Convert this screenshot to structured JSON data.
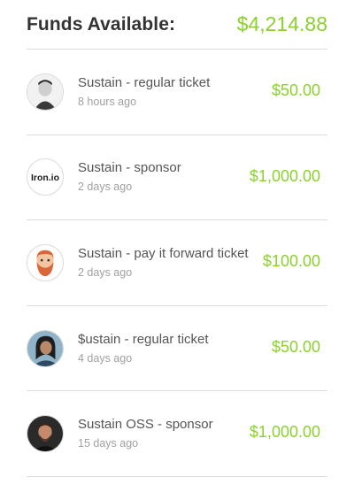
{
  "header": {
    "title": "Funds Available:",
    "amount": "$4,214.88"
  },
  "colors": {
    "accent": "#8bd12b",
    "divider": "#dcdcdc",
    "text": "#555555",
    "muted": "#a0a0a0"
  },
  "transactions": [
    {
      "title": "Sustain - regular ticket",
      "time": "8 hours ago",
      "amount": "$50.00",
      "avatar": "man-portrait-avatar"
    },
    {
      "title": "Sustain - sponsor",
      "time": "2 days ago",
      "amount": "$1,000.00",
      "avatar": "iron-io-logo"
    },
    {
      "title": "Sustain - pay it forward ticket",
      "time": "2 days ago",
      "amount": "$100.00",
      "avatar": "bearded-cartoon-avatar"
    },
    {
      "title": "$ustain - regular ticket",
      "time": "4 days ago",
      "amount": "$50.00",
      "avatar": "woman-portrait-avatar"
    },
    {
      "title": "Sustain OSS - sponsor",
      "time": "15 days ago",
      "amount": "$1,000.00",
      "avatar": "man-portrait-avatar"
    }
  ],
  "logos": {
    "iron_io": "Iron.io"
  }
}
